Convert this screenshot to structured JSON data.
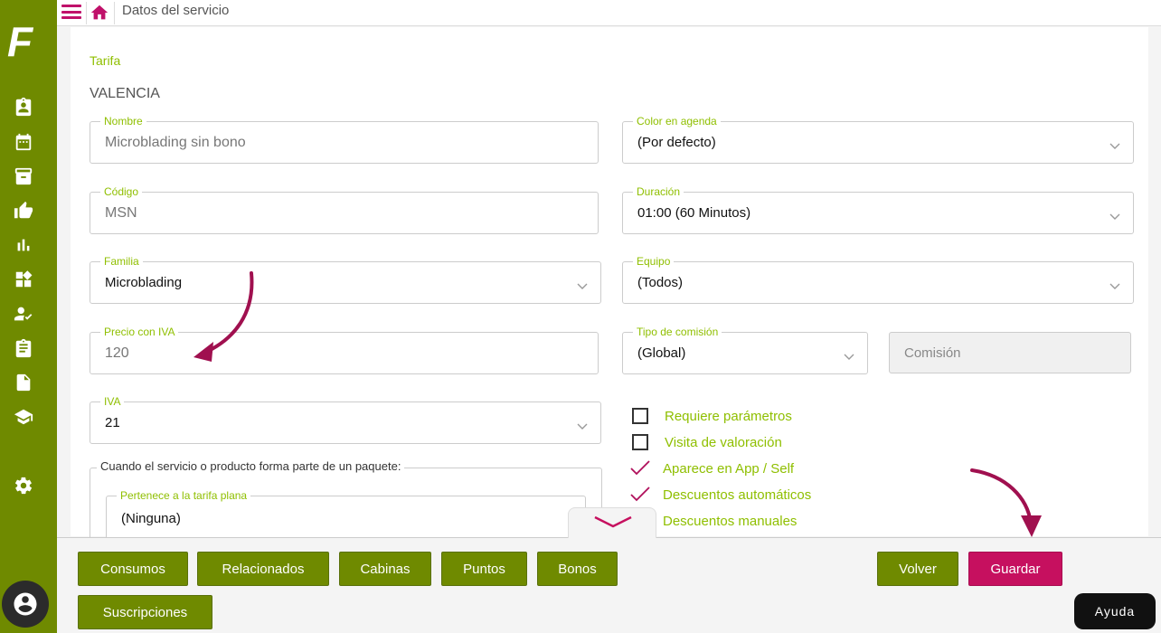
{
  "header": {
    "title": "Datos del servicio"
  },
  "logo": {
    "letter": "F"
  },
  "sidebar": {
    "icons": [
      "clipboard-user-icon",
      "calendar-icon",
      "archive-icon",
      "thumbs-up-icon",
      "bar-chart-icon",
      "widgets-icon",
      "user-check-icon",
      "clipboard-list-icon",
      "document-icon",
      "graduation-cap-icon",
      "gear-icon"
    ]
  },
  "form": {
    "section_label": "Tarifa",
    "location": "VALENCIA",
    "nombre": {
      "label": "Nombre",
      "value": "Microblading sin bono"
    },
    "codigo": {
      "label": "Código",
      "value": "MSN"
    },
    "familia": {
      "label": "Familia",
      "value": "Microblading"
    },
    "precio": {
      "label": "Precio con IVA",
      "value": "120"
    },
    "iva": {
      "label": "IVA",
      "value": "21"
    },
    "color": {
      "label": "Color en agenda",
      "value": "(Por defecto)"
    },
    "duracion": {
      "label": "Duración",
      "value": "01:00 (60 Minutos)"
    },
    "equipo": {
      "label": "Equipo",
      "value": "(Todos)"
    },
    "tipo_comision": {
      "label": "Tipo de comisión",
      "value": "(Global)"
    },
    "comision": {
      "placeholder": "Comisión"
    },
    "paquete": {
      "legend": "Cuando el servicio o producto forma parte de un paquete:",
      "tarifa_plana": {
        "label": "Pertenece a la tarifa plana",
        "value": "(Ninguna)"
      }
    },
    "checks": [
      {
        "label": "Requiere parámetros",
        "checked": false
      },
      {
        "label": "Visita de valoración",
        "checked": false
      },
      {
        "label": "Aparece en App / Self",
        "checked": true
      },
      {
        "label": "Descuentos automáticos",
        "checked": true
      },
      {
        "label": "Descuentos manuales",
        "checked": true
      }
    ]
  },
  "footer": {
    "consumos": "Consumos",
    "relacionados": "Relacionados",
    "cabinas": "Cabinas",
    "puntos": "Puntos",
    "bonos": "Bonos",
    "suscripciones": "Suscripciones",
    "volver": "Volver",
    "guardar": "Guardar"
  },
  "help": {
    "label": "Ayuda"
  },
  "colors": {
    "brand_green": "#6f8a00",
    "label_green": "#8fbf00",
    "accent_pink": "#c6105f"
  }
}
